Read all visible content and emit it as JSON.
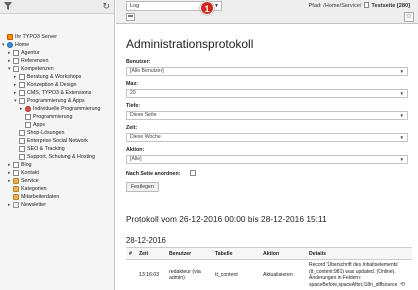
{
  "docheader": {
    "module_select": "Log",
    "badge": "1",
    "path_label": "Pfad:",
    "path_value": "/Home/Service/",
    "current_page": "Testseite [280]"
  },
  "tree": {
    "items": [
      {
        "label": "Ihr TYPO3 Server",
        "icon": "typo3-logo-icon",
        "level": 0,
        "expander": ""
      },
      {
        "label": "Home",
        "icon": "globe-icon",
        "level": 0,
        "expander": "▾"
      },
      {
        "label": "Agentur",
        "icon": "page-icon",
        "level": 1,
        "expander": "▸"
      },
      {
        "label": "Referenzen",
        "icon": "page-icon",
        "level": 1,
        "expander": "▸"
      },
      {
        "label": "Kompetenzen",
        "icon": "page-icon",
        "level": 1,
        "expander": "▾"
      },
      {
        "label": "Beratung & Workshops",
        "icon": "page-icon",
        "level": 2,
        "expander": "▸"
      },
      {
        "label": "Konzeption & Design",
        "icon": "page-icon",
        "level": 2,
        "expander": "▸"
      },
      {
        "label": "CMS, TYPO3 & Extensions",
        "icon": "page-icon",
        "level": 2,
        "expander": "▸"
      },
      {
        "label": "Programmierung & Apps",
        "icon": "page-icon",
        "level": 2,
        "expander": "▾"
      },
      {
        "label": "Individuelle Programmierung",
        "icon": "hidden-page-icon",
        "level": 3,
        "expander": "▸"
      },
      {
        "label": "Programmierung",
        "icon": "page-icon",
        "level": 3,
        "expander": ""
      },
      {
        "label": "Apps",
        "icon": "page-icon",
        "level": 3,
        "expander": ""
      },
      {
        "label": "Shop-Lösungen",
        "icon": "page-icon",
        "level": 2,
        "expander": ""
      },
      {
        "label": "Enterprise Social Network",
        "icon": "page-icon",
        "level": 2,
        "expander": ""
      },
      {
        "label": "SEO & Tracking",
        "icon": "page-icon",
        "level": 2,
        "expander": ""
      },
      {
        "label": "Support, Schulung & Hosting",
        "icon": "page-icon",
        "level": 2,
        "expander": ""
      },
      {
        "label": "Blog",
        "icon": "page-icon",
        "level": 1,
        "expander": "▸"
      },
      {
        "label": "Kontakt",
        "icon": "page-icon",
        "level": 1,
        "expander": "▸"
      },
      {
        "label": "Service",
        "icon": "folder-icon",
        "level": 1,
        "expander": "▸"
      },
      {
        "label": "Kategorien",
        "icon": "folder-icon",
        "level": 1,
        "expander": ""
      },
      {
        "label": "Mitarbeiterdaten",
        "icon": "folder-icon",
        "level": 1,
        "expander": ""
      },
      {
        "label": "Newsletter",
        "icon": "shortcut-icon",
        "level": 1,
        "expander": "▸"
      }
    ]
  },
  "main": {
    "title": "Administrationsprotokoll",
    "form": {
      "benutzer_label": "Benutzer:",
      "benutzer_value": "[Alle Benutzer]",
      "max_label": "Max:",
      "max_value": "20",
      "tiefe_label": "Tiefe:",
      "tiefe_value": "Diese Seite",
      "zeit_label": "Zeit:",
      "zeit_value": "Diese Woche",
      "aktion_label": "Aktion:",
      "aktion_value": "[Alle]",
      "sort_label": "Nach Seite anordnen:",
      "submit_label": "Festlegen"
    },
    "protocol_title": "Protokoll vom 26-12-2016 00:00 bis 28-12-2016 15:11",
    "date_heading": "28-12-2016",
    "table": {
      "headers": [
        "#",
        "Zeit",
        "Benutzer",
        "Tabelle",
        "Aktion",
        "Details"
      ],
      "rows": [
        {
          "time": "13:16:03",
          "user": "redakteur (via admin)",
          "table": "tt_content",
          "action": "Aktualisieren",
          "details": "Record 'Überschrift des Inhaltselements' (tt_content:981) was updated. (Online). Änderungen in Feldern: spaceBefore,spaceAfter,l18n_diffsource."
        }
      ]
    }
  }
}
